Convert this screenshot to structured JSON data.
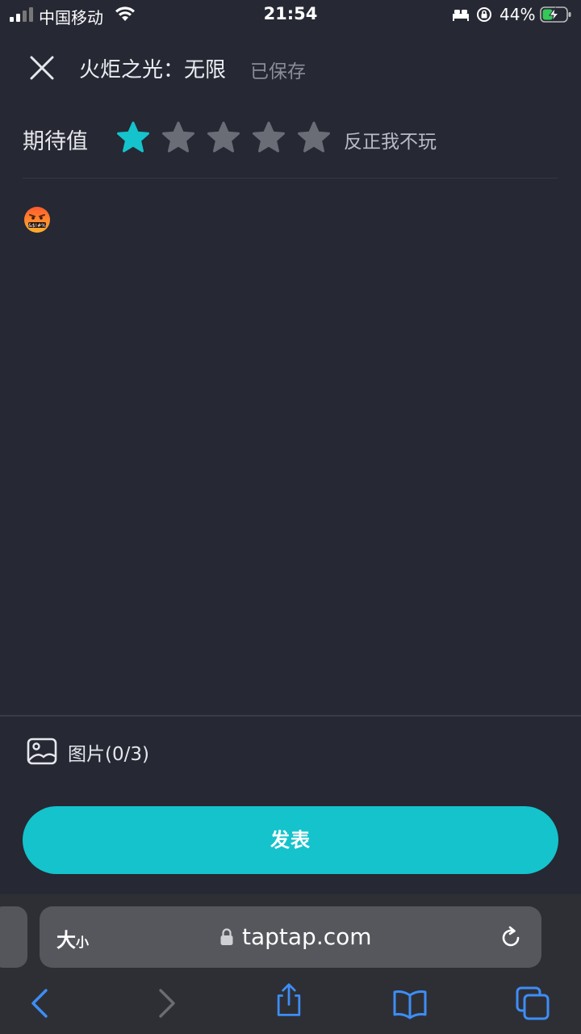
{
  "status_bar": {
    "carrier": "中国移动",
    "time": "21:54",
    "battery_percent": "44%",
    "battery_level": 0.44,
    "icons": [
      "signal-icon",
      "wifi-icon",
      "bed-icon",
      "orientation-lock-icon",
      "battery-charging-icon"
    ]
  },
  "header": {
    "title": "火炬之光：无限",
    "saved_status": "已保存"
  },
  "rating": {
    "label": "期待值",
    "max_stars": 5,
    "value": 1,
    "value_text": "反正我不玩",
    "active_color": "#14c3cc",
    "inactive_color": "#6a6c76"
  },
  "editor": {
    "emoji": "🤬"
  },
  "attachments": {
    "label": "图片(0/3)"
  },
  "publish": {
    "label": "发表",
    "color": "#14c3cc"
  },
  "browser": {
    "text_size_label_big": "大",
    "text_size_label_small": "小",
    "url": "taptap.com",
    "accent": "#3d8ef7"
  }
}
